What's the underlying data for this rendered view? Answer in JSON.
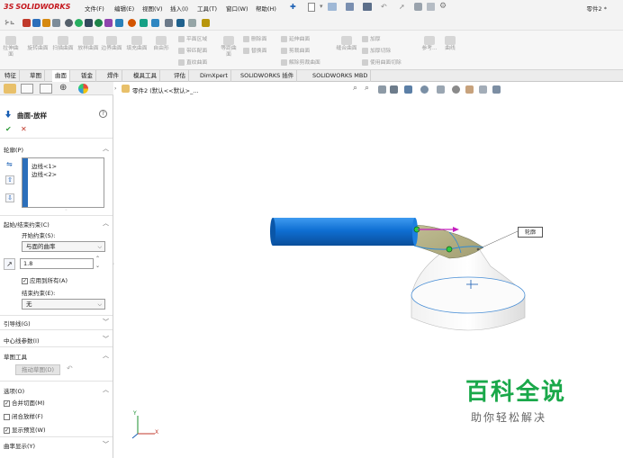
{
  "app": {
    "logo": "SOLIDWORKS",
    "logo_prefix": "3S",
    "doc_title": "零件2 *"
  },
  "menu": [
    "文件(F)",
    "编辑(E)",
    "视图(V)",
    "插入(I)",
    "工具(T)",
    "窗口(W)",
    "帮助(H)"
  ],
  "ribbon": {
    "big_buttons": [
      "拉伸曲面",
      "旋转曲面",
      "扫描曲面",
      "放样曲面",
      "边界曲面",
      "填充曲面",
      "自由形"
    ],
    "stack1": [
      "平面区域",
      "带匹配面",
      "直纹曲面"
    ],
    "stack1_extra": "等距曲面",
    "stack2": [
      "删除面",
      "替换面"
    ],
    "stack3": [
      "延伸曲面",
      "剪裁曲面",
      "解除剪裁曲面"
    ],
    "knit": "缝合曲面",
    "stack4": [
      "加厚",
      "加厚切除",
      "使用曲面切除"
    ],
    "ref_geometry": "参考...",
    "curves": "曲线"
  },
  "tabs": [
    "特征",
    "草图",
    "曲面",
    "钣金",
    "焊件",
    "模具工具",
    "评估",
    "DimXpert",
    "SOLIDWORKS 插件",
    "SOLIDWORKS MBD"
  ],
  "active_tab": "曲面",
  "feature": {
    "title": "曲面-放样",
    "profiles_label": "轮廓(P)",
    "profiles": [
      "边线<1>",
      "边线<2>"
    ],
    "start_end_label": "起始/结束约束(C)",
    "start_constraint_label": "开始约束(S):",
    "start_constraint_value": "与面的曲率",
    "tangent_length": "1.8",
    "apply_all_label": "应用到所有(A)",
    "end_constraint_label": "结束约束(E):",
    "end_constraint_value": "无",
    "guides_label": "引导线(G)",
    "centerline_label": "中心线参数(I)",
    "sketch_tools_label": "草图工具",
    "drag_sketch_label": "拖动草图(D)",
    "options_label": "选项(O)",
    "merge_faces_label": "合并切面(M)",
    "close_loft_label": "闭合放样(F)",
    "show_preview_label": "显示预览(W)",
    "curvature_display_label": "曲率显示(Y)"
  },
  "viewport": {
    "tree_label": "零件2 (默认<<默认>_...",
    "callout": "轮廓",
    "axis_x": "X",
    "axis_y": "Y"
  },
  "watermark": {
    "title": "百科全说",
    "subtitle": "助你轻松解决"
  },
  "colors": {
    "accent": "#1565c0",
    "brand_red": "#c4161c",
    "watermark_green": "#1aa84a"
  }
}
